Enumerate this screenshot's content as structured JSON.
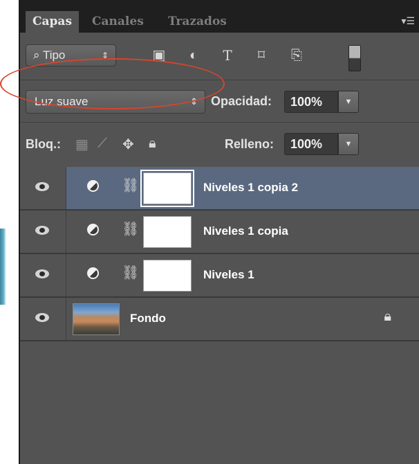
{
  "tabs": [
    "Capas",
    "Canales",
    "Trazados"
  ],
  "filter": {
    "label": "Tipo",
    "arrows": "⇕"
  },
  "filter_icons": [
    "image-filter-icon",
    "adjustment-filter-icon",
    "text-filter-icon",
    "shape-filter-icon",
    "smartobject-filter-icon"
  ],
  "blend": {
    "mode": "Luz suave",
    "arrows": "⇕",
    "opacity_label": "Opacidad:",
    "opacity_value": "100%"
  },
  "lock": {
    "label": "Bloq.:",
    "fill_label": "Relleno:",
    "fill_value": "100%"
  },
  "layers": [
    {
      "name": "Niveles 1 copia 2",
      "selected": true
    },
    {
      "name": "Niveles 1 copia",
      "selected": false
    },
    {
      "name": "Niveles 1",
      "selected": false
    }
  ],
  "background_layer": {
    "name": "Fondo"
  },
  "colors": {
    "selection": "#5a6980",
    "highlight_ellipse": "#d8442c"
  }
}
